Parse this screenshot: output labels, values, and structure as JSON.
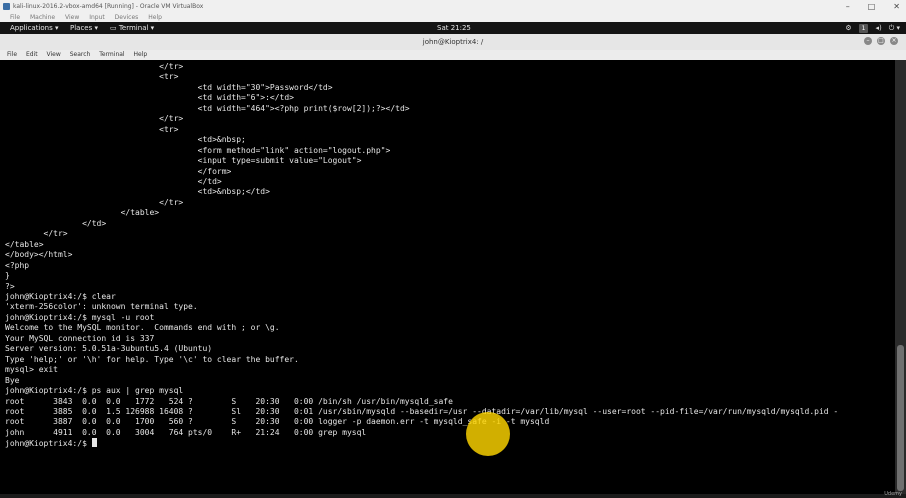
{
  "vbox": {
    "title": "kali-linux-2016.2-vbox-amd64 [Running] - Oracle VM VirtualBox",
    "menu": [
      "File",
      "Machine",
      "View",
      "Input",
      "Devices",
      "Help"
    ],
    "controls": [
      "–",
      "□",
      "✕"
    ]
  },
  "panel": {
    "applications": "Applications ▾",
    "places": "Places ▾",
    "terminal": "Terminal ▾",
    "clock": "Sat 21:25",
    "workspace": "1",
    "status_icons": [
      "⚙",
      "◂)",
      "⏻ ▾"
    ]
  },
  "terminal": {
    "title": "john@Kioptrix4: /",
    "menu": [
      "File",
      "Edit",
      "View",
      "Search",
      "Terminal",
      "Help"
    ],
    "lines": [
      "                                </tr>",
      "                                <tr>",
      "                                        <td width=\"30\">Password</td>",
      "                                        <td width=\"6\">:</td>",
      "                                        <td width=\"464\"><?php print($row[2]);?></td>",
      "                                </tr>",
      "                                <tr>",
      "                                        <td>&nbsp;",
      "                                        <form method=\"link\" action=\"logout.php\">",
      "                                        <input type=submit value=\"Logout\">",
      "                                        </form>",
      "                                        </td>",
      "                                        <td>&nbsp;</td>",
      "                                </tr>",
      "                        </table>",
      "                </td>",
      "        </tr>",
      "</table>",
      "</body></html>",
      "",
      "<?php",
      "}",
      "?>",
      "john@Kioptrix4:/$ clear",
      "'xterm-256color': unknown terminal type.",
      "john@Kioptrix4:/$ mysql -u root",
      "Welcome to the MySQL monitor.  Commands end with ; or \\g.",
      "Your MySQL connection id is 337",
      "Server version: 5.0.51a-3ubuntu5.4 (Ubuntu)",
      "",
      "Type 'help;' or '\\h' for help. Type '\\c' to clear the buffer.",
      "",
      "mysql> exit",
      "Bye",
      "john@Kioptrix4:/$ ps aux | grep mysql",
      "root      3843  0.0  0.0   1772   524 ?        S    20:30   0:00 /bin/sh /usr/bin/mysqld_safe",
      "root      3885  0.0  1.5 126988 16408 ?        Sl   20:30   0:01 /usr/sbin/mysqld --basedir=/usr --datadir=/var/lib/mysql --user=root --pid-file=/var/run/mysqld/mysqld.pid -",
      "root      3887  0.0  0.0   1700   560 ?        S    20:30   0:00 logger -p daemon.err -t mysqld_safe -i -t mysqld",
      "john      4911  0.0  0.0   3004   764 pts/0    R+   21:24   0:00 grep mysql"
    ],
    "prompt": "john@Kioptrix4:/$ "
  },
  "watermark": "Udemy"
}
